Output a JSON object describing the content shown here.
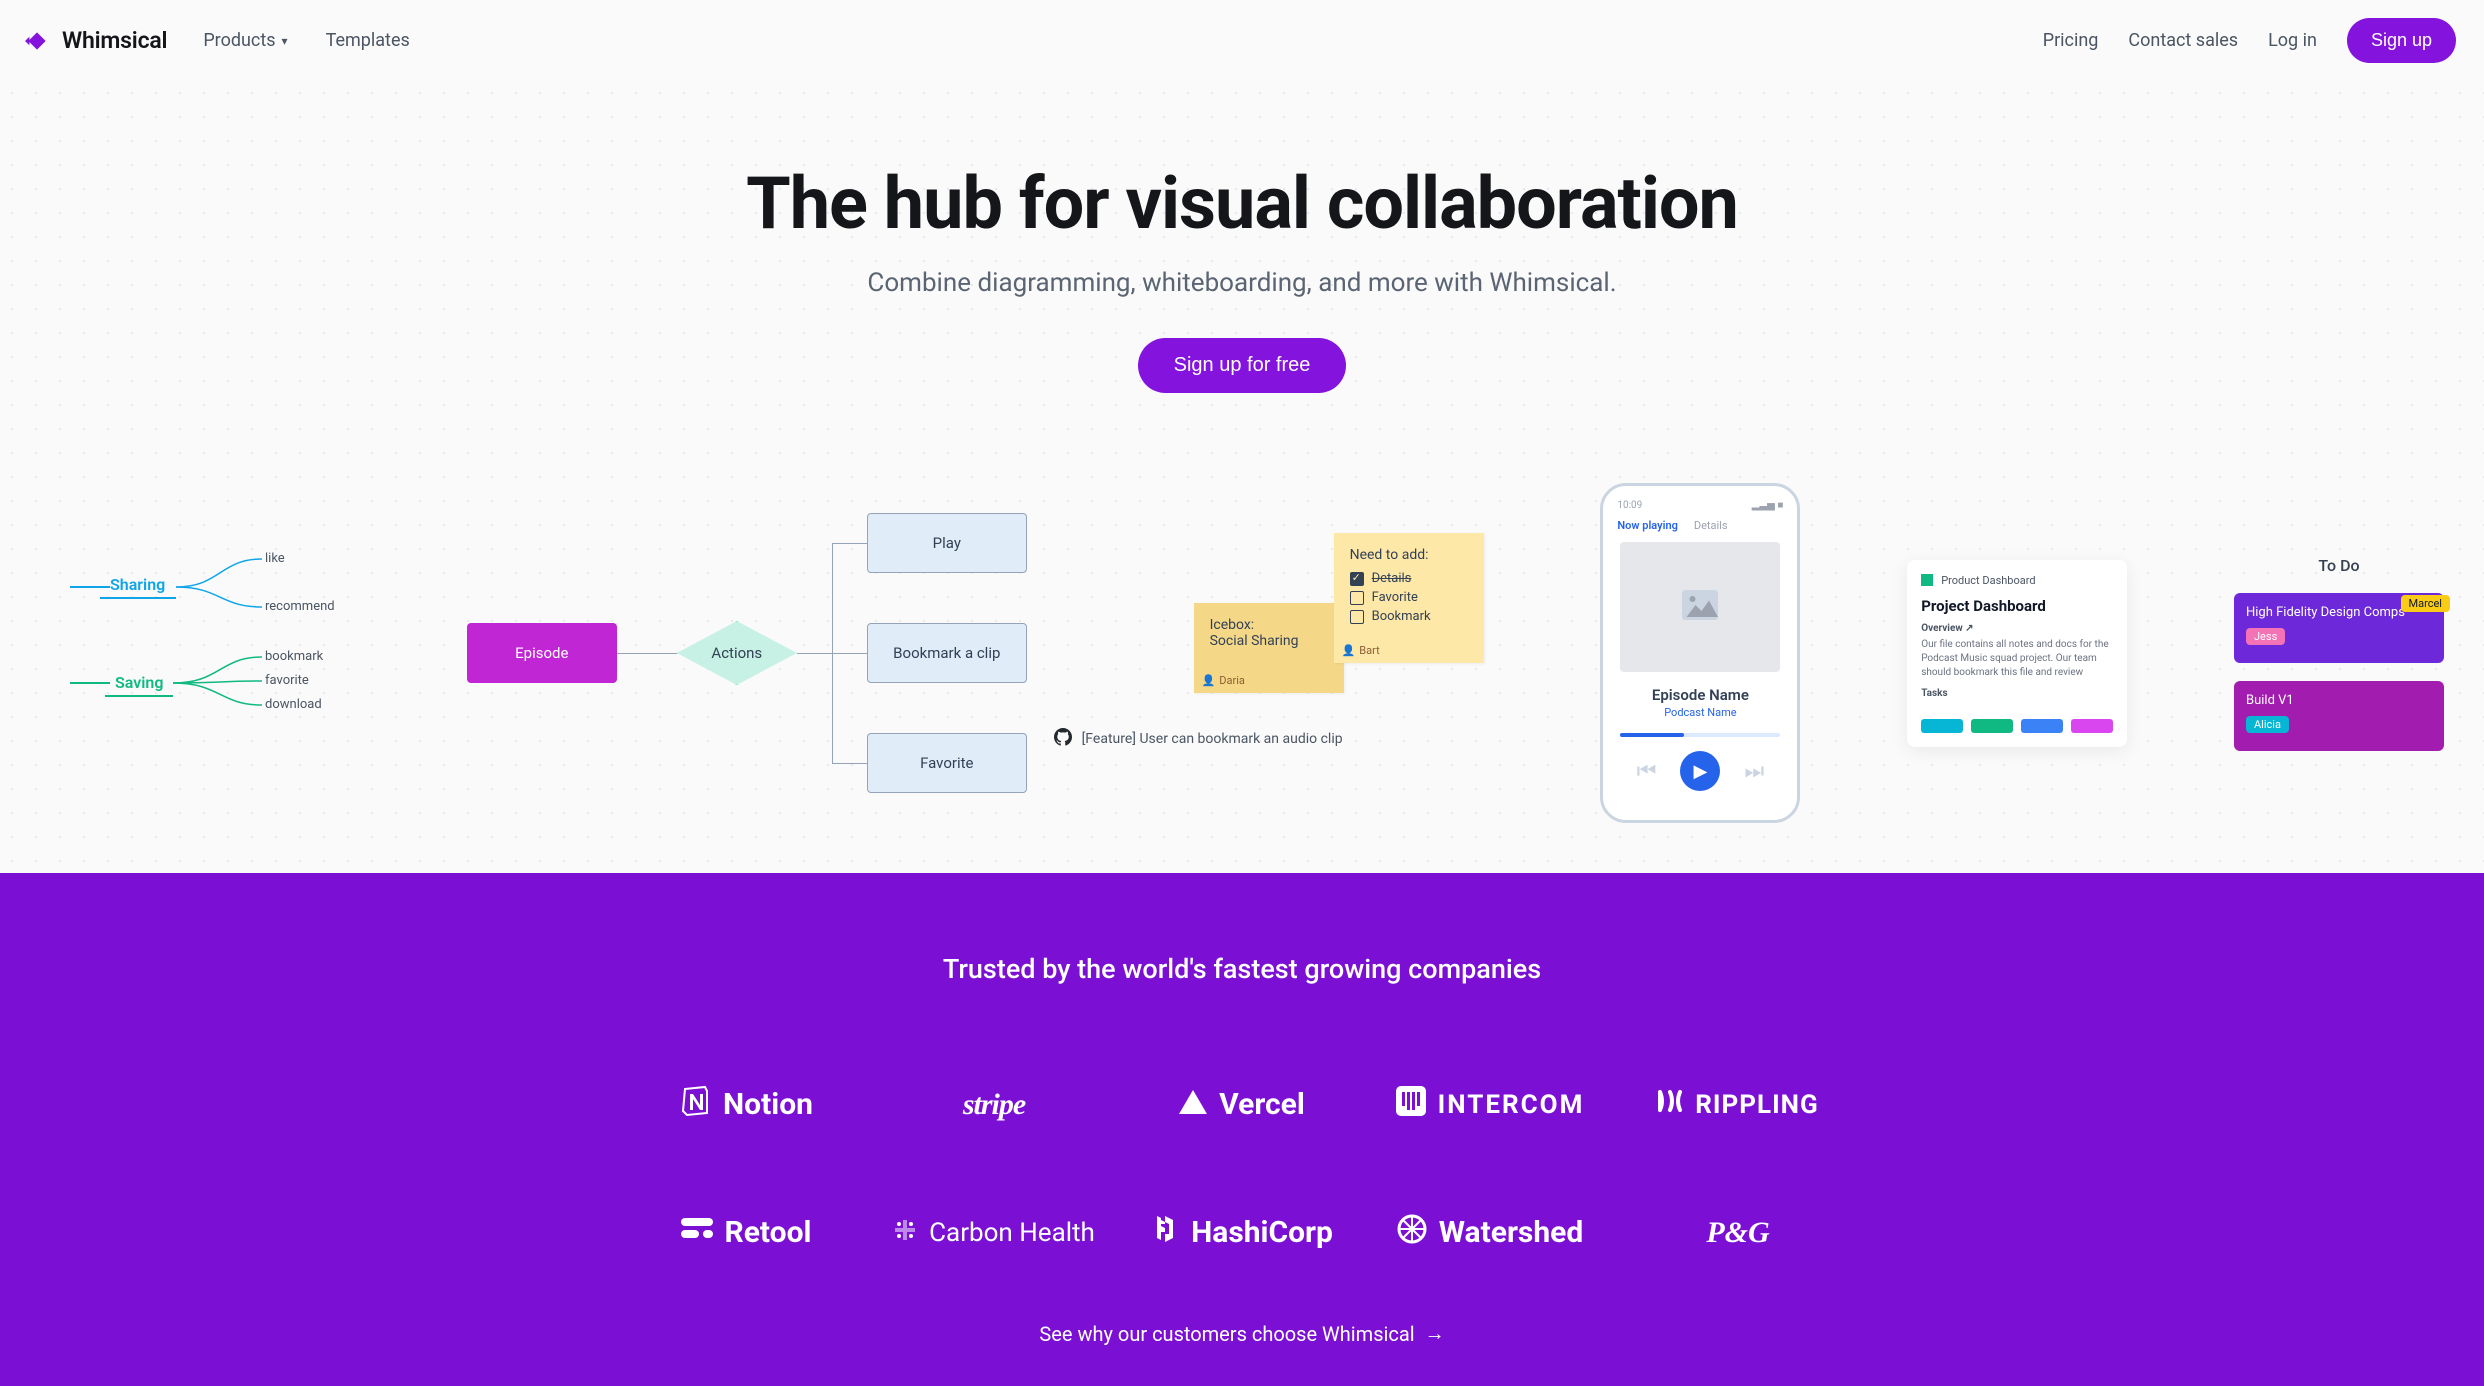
{
  "header": {
    "brand": "Whimsical",
    "nav_products": "Products",
    "nav_templates": "Templates",
    "link_pricing": "Pricing",
    "link_contact": "Contact sales",
    "link_login": "Log in",
    "btn_signup": "Sign up"
  },
  "hero": {
    "title": "The hub for visual collaboration",
    "subtitle": "Combine diagramming, whiteboarding, and more with Whimsical.",
    "cta": "Sign up for free"
  },
  "illus": {
    "mindmap": {
      "sharing": "Sharing",
      "saving": "Saving",
      "like": "like",
      "recommend": "recommend",
      "bookmark": "bookmark",
      "favorite": "favorite",
      "download": "download"
    },
    "flow": {
      "episode": "Episode",
      "actions": "Actions",
      "play": "Play",
      "bookmark": "Bookmark a clip",
      "favorite": "Favorite"
    },
    "stickies": {
      "icebox_l1": "Icebox:",
      "icebox_l2": "Social Sharing",
      "icebox_user": "Daria",
      "need_title": "Need to add:",
      "need_details": "Details",
      "need_favorite": "Favorite",
      "need_bookmark": "Bookmark",
      "need_user": "Bart"
    },
    "github": "[Feature] User can bookmark an audio clip",
    "phone": {
      "time": "10:09",
      "tab_now": "Now playing",
      "tab_details": "Details",
      "ep_name": "Episode Name",
      "pod_name": "Podcast Name"
    },
    "dash": {
      "tab": "Product Dashboard",
      "h1": "Project Dashboard",
      "overview": "Overview",
      "body": "Our file contains all notes and docs for the Podcast Music squad project. Our team should bookmark this file and review regularly.",
      "tasks": "Tasks"
    },
    "kanban": {
      "title": "To Do",
      "card1": "High Fidelity Design Comps",
      "label_jess": "Jess",
      "label_marcel": "Marcel",
      "card2": "Build V1",
      "label_alicia": "Alicia"
    }
  },
  "purple": {
    "heading": "Trusted by the world's fastest growing companies",
    "logos": [
      "Notion",
      "stripe",
      "Vercel",
      "INTERCOM",
      "RIPPLING",
      "Retool",
      "Carbon Health",
      "HashiCorp",
      "Watershed",
      "P&G"
    ],
    "cta": "See why our customers choose Whimsical"
  }
}
